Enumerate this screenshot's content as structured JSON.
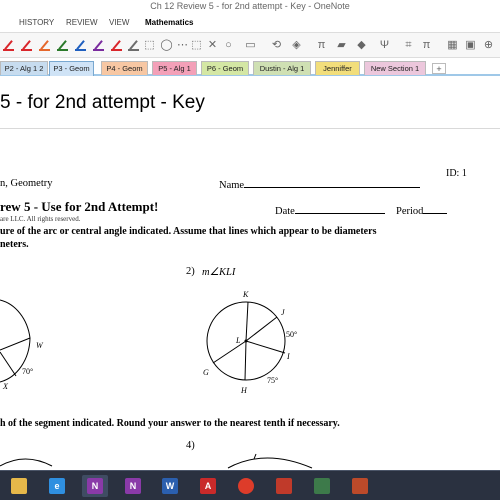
{
  "window": {
    "title": "Ch 12 Review 5 - for 2nd attempt - Key - OneNote"
  },
  "ribbon": {
    "menu": [
      "HISTORY",
      "REVIEW",
      "VIEW",
      "Mathematics"
    ],
    "pen_colors": [
      "#d9262b",
      "#d9262b",
      "#e5672b",
      "#2b7a2b",
      "#1f5fbf",
      "#7a2b9e",
      "#d9262b",
      "#6c6c6c"
    ],
    "pi_symbol": "π",
    "pi_symbol_2": "π"
  },
  "sections": {
    "tabs": [
      {
        "label": "P2 - Alg 1 2",
        "color": "#c7dcef"
      },
      {
        "label": "P3 - Geom",
        "color": "#cfe3f6"
      },
      {
        "label": "P4 - Geom",
        "color": "#f7c7a3"
      },
      {
        "label": "P5 - Alg 1",
        "color": "#f3a0b8"
      },
      {
        "label": "P6 - Geom",
        "color": "#d4e7a4"
      },
      {
        "label": "Dustin - Alg 1",
        "color": "#cfe0b3"
      },
      {
        "label": "Jenniffer",
        "color": "#f2de7b"
      },
      {
        "label": "New Section 1",
        "color": "#ecc7dc"
      }
    ],
    "add_label": "+"
  },
  "page": {
    "title": "5 - for 2nd attempt - Key",
    "worksheet": {
      "id_label": "ID: 1",
      "course": "n, Geometry",
      "name_label": "Name",
      "heading": "rew 5 - Use for 2nd Attempt!",
      "copyright": "are LLC.  All rights reserved.",
      "date_label": "Date",
      "period_label": "Period",
      "instruction_1": "ure of the arc or central angle indicated.  Assume that lines which appear to be diameters",
      "instruction_1b": "neters.",
      "problem_2_label": "2)",
      "problem_2_expr": "m∠KLI",
      "fig1_labels": {
        "w": "W",
        "angle": "70°",
        "x": "X"
      },
      "fig2_labels": {
        "k": "K",
        "j": "J",
        "l": "L",
        "i": "I",
        "g": "G",
        "h": "H",
        "angle_a": "50°",
        "angle_b": "75°"
      },
      "instruction_2": "h of the segment indicated.  Round your answer to the nearest tenth if necessary.",
      "problem_4_label": "4)"
    }
  },
  "taskbar": {
    "apps": [
      {
        "icon": "folder-icon",
        "label": "",
        "color": "#e6b84a"
      },
      {
        "icon": "internet-explorer-icon",
        "label": "e",
        "color": "#2f8fe0"
      },
      {
        "icon": "onenote-icon",
        "label": "N",
        "color": "#8a3aa8"
      },
      {
        "icon": "onenote-icon",
        "label": "N",
        "color": "#8a3aa8"
      },
      {
        "icon": "word-icon",
        "label": "W",
        "color": "#2b5fae"
      },
      {
        "icon": "acrobat-icon",
        "label": "A",
        "color": "#c92a2a"
      },
      {
        "icon": "chrome-icon",
        "label": "",
        "color": "#dd3c2a"
      },
      {
        "icon": "snipping-tool-icon",
        "label": "",
        "color": "#c03a2a"
      },
      {
        "icon": "game-icon",
        "label": "",
        "color": "#3d7a4a"
      },
      {
        "icon": "presentation-icon",
        "label": "",
        "color": "#bc4a2a"
      }
    ]
  }
}
